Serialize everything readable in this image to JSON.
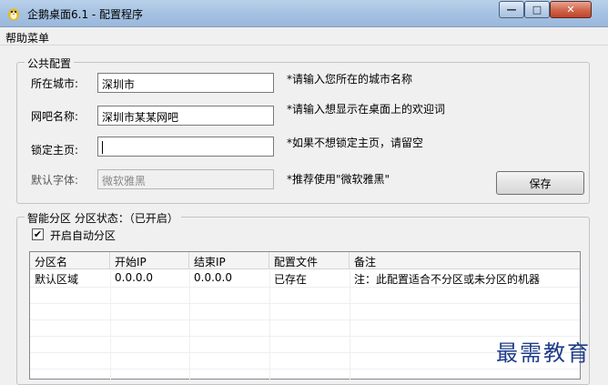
{
  "window": {
    "title": "企鹅桌面6.1 - 配置程序",
    "min_glyph": "—",
    "max_glyph": "□",
    "close_glyph": "✕"
  },
  "menubar": {
    "help": "帮助菜单"
  },
  "public_config": {
    "legend": "公共配置",
    "city": {
      "label": "所在城市:",
      "value": "深圳市",
      "hint": "*请输入您所在的城市名称"
    },
    "netbar": {
      "label": "网吧名称:",
      "value": "深圳市某某网吧",
      "hint": "*请输入想显示在桌面上的欢迎词"
    },
    "homepage": {
      "label": "锁定主页:",
      "value": "",
      "hint": "*如果不想锁定主页，请留空"
    },
    "font": {
      "label": "默认字体:",
      "value": "微软雅黑",
      "hint": "*推荐使用\"微软雅黑\""
    },
    "save_button": "保存"
  },
  "smart_partition": {
    "legend": "智能分区 分区状态：（已开启）",
    "auto_checkbox_label": "开启自动分区",
    "auto_checked": true,
    "columns": [
      "分区名",
      "开始IP",
      "结束IP",
      "配置文件",
      "备注"
    ],
    "rows": [
      [
        "默认区域",
        "0.0.0.0",
        "0.0.0.0",
        "已存在",
        "注：此配置适合不分区或未分区的机器"
      ]
    ]
  },
  "watermark": "最需教育",
  "colors": {
    "titlebar": "#a6c2e2",
    "close_button": "#c0432a",
    "watermark": "#1f3d8a"
  }
}
